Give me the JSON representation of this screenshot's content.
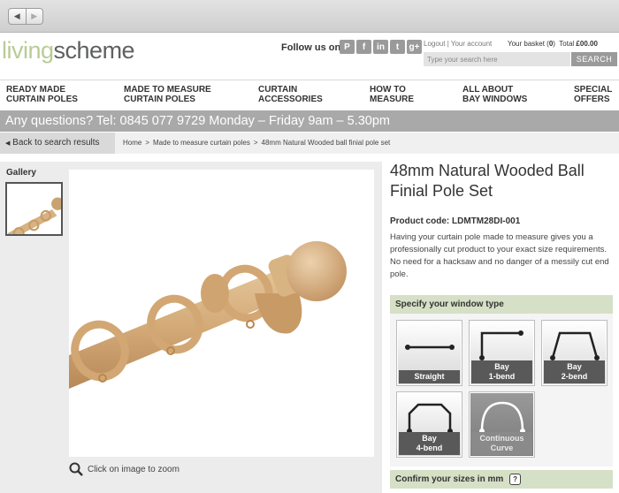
{
  "header": {
    "logo_part1": "living",
    "logo_part2": "scheme",
    "follow_label": "Follow us on",
    "social_icons": [
      "pinterest-icon",
      "facebook-icon",
      "linkedin-icon",
      "tumblr-icon",
      "google-plus-icon"
    ],
    "social_glyphs": [
      "P",
      "f",
      "in",
      "t",
      "g+"
    ],
    "logout": "Logout",
    "your_account": "Your account",
    "basket_label": "Your basket (",
    "basket_count": "0",
    "basket_close": ")",
    "total_label": "Total",
    "total_value": "£00.00",
    "search_placeholder": "Type your search here",
    "search_button": "SEARCH"
  },
  "nav": [
    {
      "label": "READY MADE\nCURTAIN POLES"
    },
    {
      "label": "MADE TO MEASURE\nCURTAIN POLES"
    },
    {
      "label": "CURTAIN\nACCESSORIES"
    },
    {
      "label": "HOW TO\nMEASURE"
    },
    {
      "label": "ALL ABOUT\nBAY WINDOWS"
    },
    {
      "label": "SPECIAL\nOFFERS"
    }
  ],
  "banner": "Any questions?  Tel: 0845 077 9729  Monday – Friday 9am – 5.30pm",
  "breadcrumb": {
    "back": "Back to search results",
    "items": [
      "Home",
      "Made to measure curtain poles",
      "48mm Natural Wooded ball finial pole set"
    ]
  },
  "gallery": {
    "label": "Gallery",
    "zoom_text": "Click on image to zoom"
  },
  "product": {
    "title": "48mm Natural Wooded Ball Finial Pole Set",
    "code_label": "Product code:",
    "code": "LDMTM28DI-001",
    "description": "Having your curtain pole made to measure gives you a professionally cut product to your exact size requirements. No need for a hacksaw and no danger of a messily cut end pole."
  },
  "window_type": {
    "heading": "Specify your window type",
    "options": [
      {
        "label": "Straight"
      },
      {
        "label": "Bay\n1-bend"
      },
      {
        "label": "Bay\n2-bend"
      },
      {
        "label": "Bay\n4-bend"
      },
      {
        "label": "Continuous\nCurve"
      }
    ]
  },
  "sizes": {
    "heading": "Confirm your sizes in mm",
    "help": "?"
  }
}
